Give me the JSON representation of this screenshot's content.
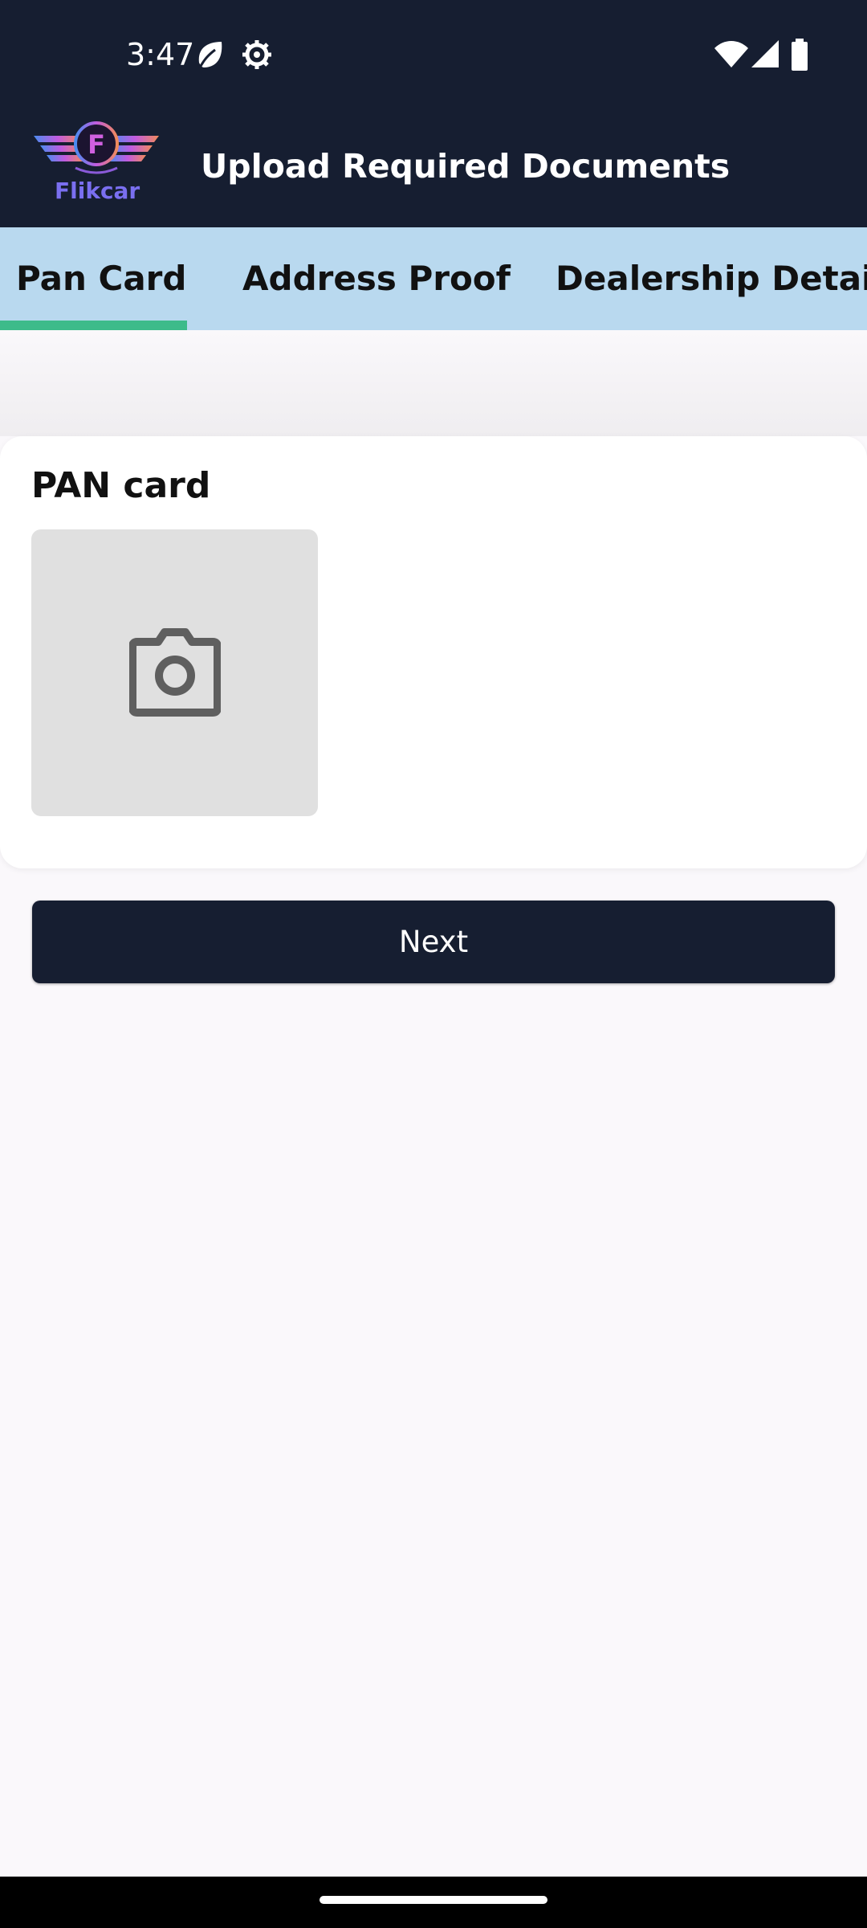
{
  "status_bar": {
    "time": "3:47",
    "icons": [
      "leaf-icon",
      "settings-gear-icon",
      "wifi-icon",
      "cellular-signal-icon",
      "battery-icon"
    ]
  },
  "app_bar": {
    "logo_text": "Flikcar",
    "title": "Upload Required Documents"
  },
  "tabs": [
    {
      "label": "Pan Card",
      "selected": true
    },
    {
      "label": "Address Proof",
      "selected": false
    },
    {
      "label": "Dealership Details",
      "selected": false
    }
  ],
  "card": {
    "title": "PAN card",
    "upload_icon": "camera-icon"
  },
  "next_button": {
    "label": "Next"
  },
  "colors": {
    "header": "#161e31",
    "tab_bar": "#b9d9ef",
    "tab_indicator": "#3dbb8a",
    "upload_box": "#e0e0e0",
    "button": "#161e31"
  }
}
